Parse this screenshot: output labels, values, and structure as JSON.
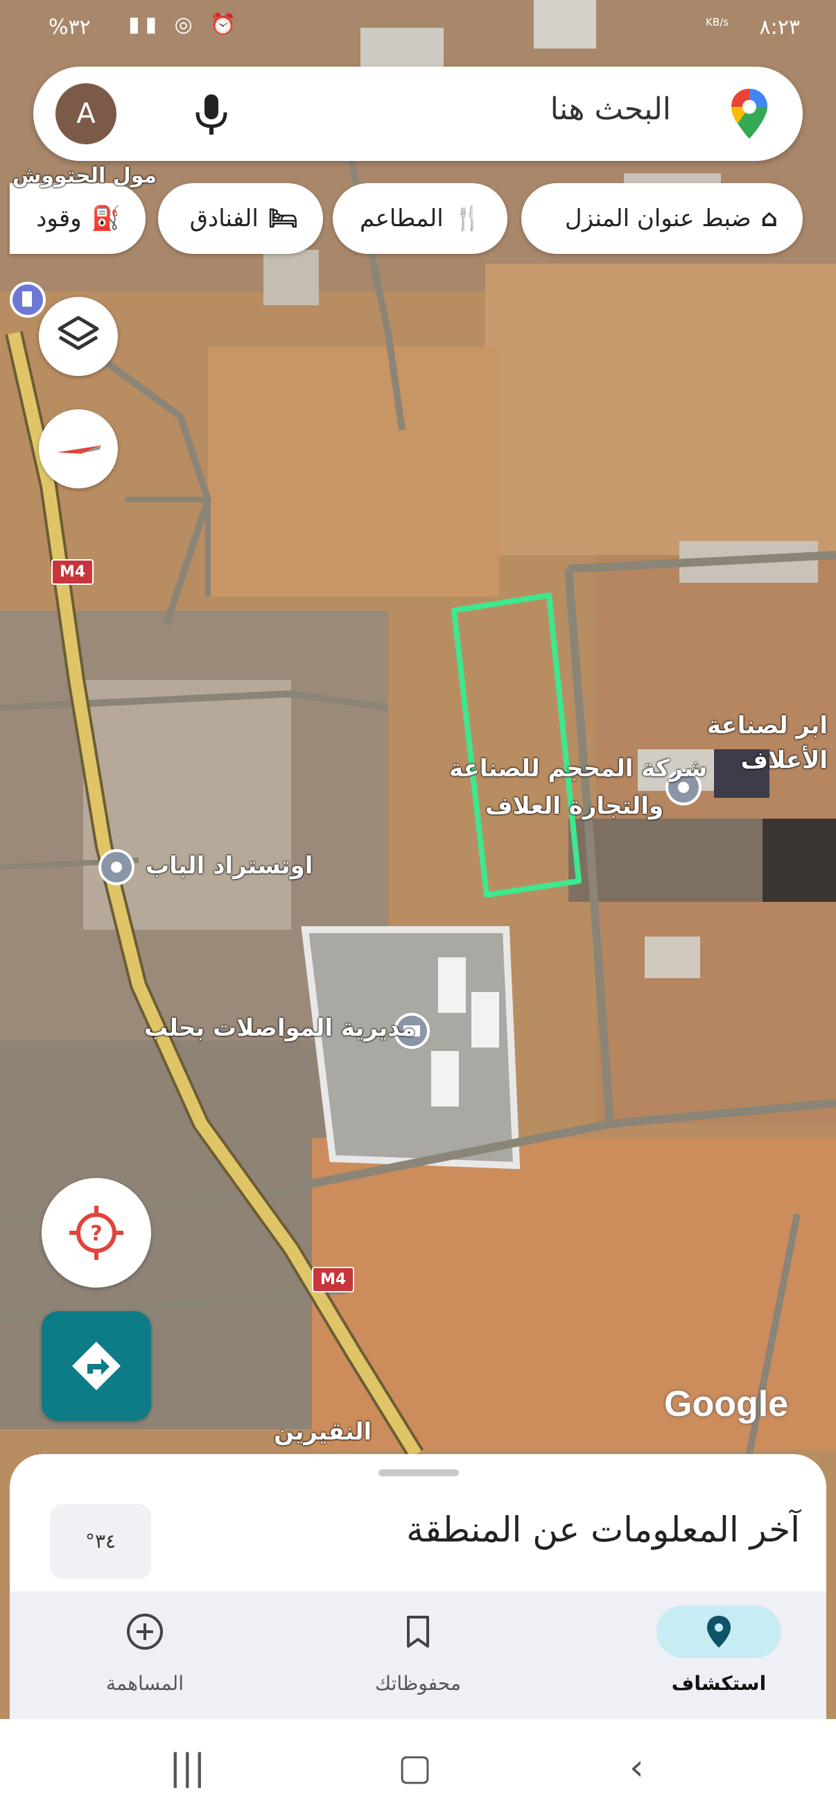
{
  "status_bar": {
    "time": "٨:٢٣",
    "network_speed": "KB/s",
    "battery": "%٣٢"
  },
  "search": {
    "placeholder": "البحث هنا",
    "avatar_letter": "A"
  },
  "chips": [
    {
      "label": "ضبط عنوان المنزل",
      "icon": "home-icon"
    },
    {
      "label": "المطاعم",
      "icon": "restaurant-icon"
    },
    {
      "label": "الفنادق",
      "icon": "hotel-icon"
    },
    {
      "label": "وقود",
      "icon": "fuel-icon"
    }
  ],
  "map": {
    "labels": {
      "mall": "مول الحتووش",
      "company_line1": "شركة المحجم للصناعة",
      "company_line2": "والتجارة العلاف",
      "company_right_line1": "ابر لصناعة",
      "company_right_line2": "الأعلاف",
      "bab_station": "اوتستراد الباب",
      "telecom": "مديرية المواصلات بحلب",
      "naqarin": "النقيرين"
    },
    "road_shields": [
      "M4",
      "M4"
    ],
    "attribution": "Google",
    "colors": {
      "highlight": "#3ee88f",
      "road": "#d9c06a"
    }
  },
  "sheet": {
    "title": "آخر المعلومات عن المنطقة",
    "temperature": "°٣٤"
  },
  "bottom_nav": {
    "explore": "استكشاف",
    "saved": "محفوظاتك",
    "contribute": "المساهمة"
  }
}
